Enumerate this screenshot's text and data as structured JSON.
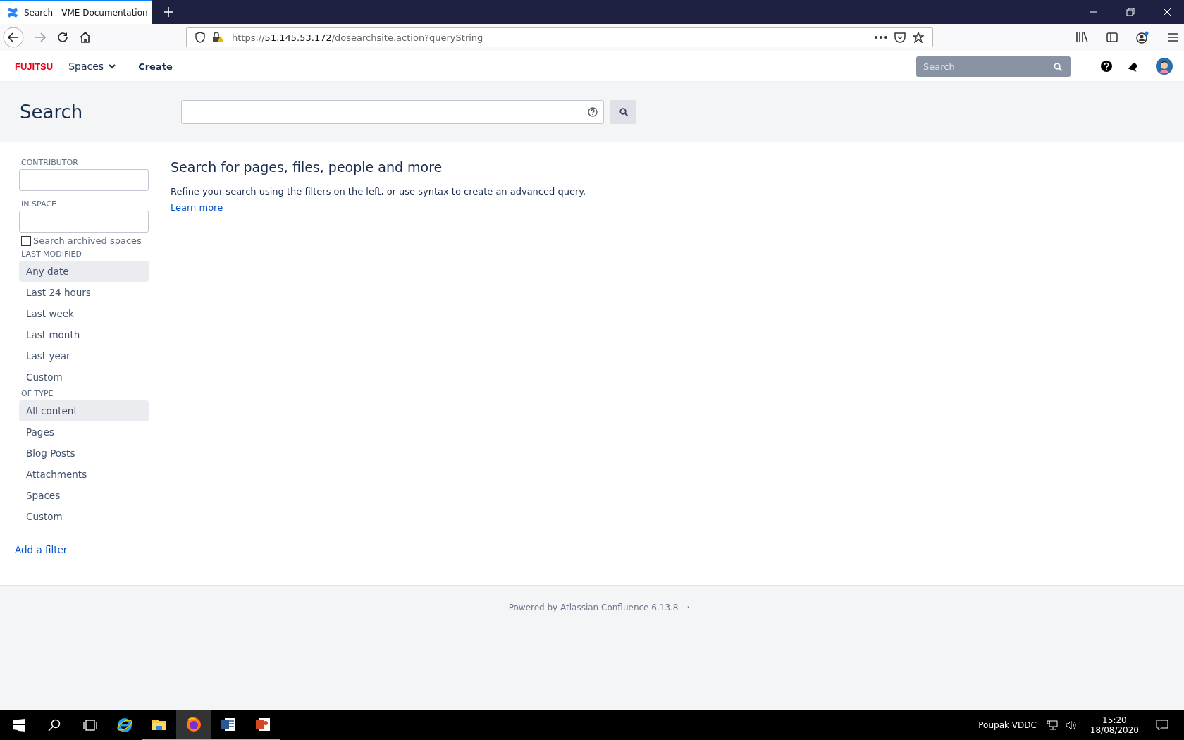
{
  "browser": {
    "tabs": [
      {
        "title": "Search - VME Documentation",
        "selected": true
      }
    ],
    "url": {
      "scheme": "https://",
      "host": "51.145.53.172",
      "path": "/dosearchsite.action?queryString="
    }
  },
  "header": {
    "logo": "FUJITSU",
    "nav": [
      {
        "label": "Spaces",
        "kind": "dropdown"
      },
      {
        "label": "Create",
        "kind": "button"
      }
    ],
    "search": {
      "placeholder": "Search"
    }
  },
  "banner": {
    "title": "Search"
  },
  "sidebar": {
    "contributor_label": "CONTRIBUTOR",
    "space_label": "IN SPACE",
    "archived": {
      "label": "Search archived spaces",
      "checked": false
    },
    "groups": [
      {
        "title": "LAST MODIFIED",
        "options": [
          {
            "label": "Any date",
            "selected": true
          },
          {
            "label": "Last 24 hours",
            "selected": false
          },
          {
            "label": "Last week",
            "selected": false
          },
          {
            "label": "Last month",
            "selected": false
          },
          {
            "label": "Last year",
            "selected": false
          },
          {
            "label": "Custom",
            "selected": false
          }
        ]
      },
      {
        "title": "OF TYPE",
        "options": [
          {
            "label": "All content",
            "selected": true
          },
          {
            "label": "Pages",
            "selected": false
          },
          {
            "label": "Blog Posts",
            "selected": false
          },
          {
            "label": "Attachments",
            "selected": false
          },
          {
            "label": "Spaces",
            "selected": false
          },
          {
            "label": "Custom",
            "selected": false
          }
        ]
      }
    ],
    "add_filter": "Add a filter"
  },
  "main": {
    "heading": "Search for pages, files, people and more",
    "description": "Refine your search using the filters on the left, or use syntax to create an advanced query.",
    "link": "Learn more"
  },
  "footer": {
    "text": "Powered by Atlassian Confluence 6.13.8",
    "separator": "·"
  },
  "taskbar": {
    "apps": [
      {
        "kind": "ie",
        "running": false,
        "selected": false
      },
      {
        "kind": "explorer",
        "running": true,
        "selected": false
      },
      {
        "kind": "firefox",
        "running": true,
        "selected": true
      },
      {
        "kind": "word",
        "running": true,
        "selected": false
      },
      {
        "kind": "powerpoint",
        "running": true,
        "selected": false
      }
    ],
    "user": "Poupak VDDC",
    "time": "15:20",
    "date": "18/08/2020"
  }
}
